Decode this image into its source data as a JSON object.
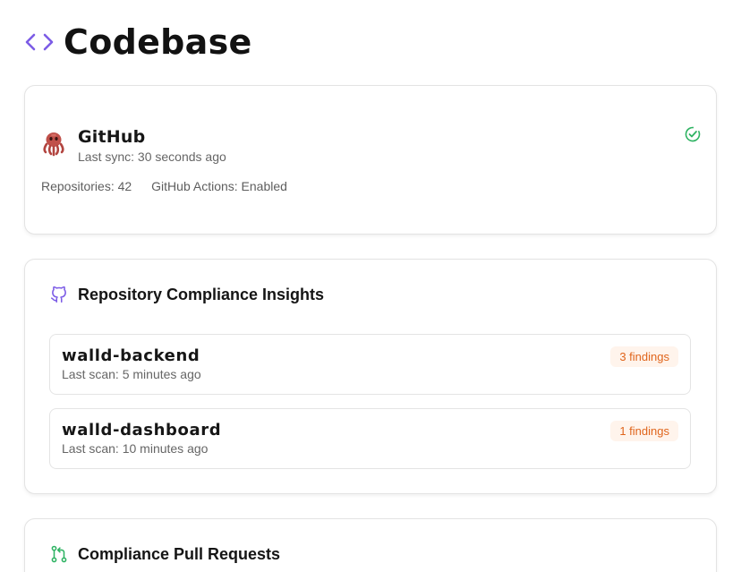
{
  "header": {
    "title": "Codebase",
    "icon": "code-brackets-icon",
    "accent": "#7c5ce6"
  },
  "integration": {
    "name": "GitHub",
    "last_sync": "Last sync: 30 seconds ago",
    "repositories": "Repositories: 42",
    "actions": "GitHub Actions: Enabled",
    "status_icon": "check-circle-icon",
    "status_color": "#2fb363"
  },
  "insights": {
    "title": "Repository Compliance Insights",
    "icon": "github-icon",
    "repos": [
      {
        "name": "walld-backend",
        "last_scan": "Last scan: 5 minutes ago",
        "findings": "3 findings"
      },
      {
        "name": "walld-dashboard",
        "last_scan": "Last scan: 10 minutes ago",
        "findings": "1 findings"
      }
    ],
    "badge_color": "#e0651c"
  },
  "pull_requests": {
    "title": "Compliance Pull Requests",
    "icon": "git-pull-request-icon",
    "icon_color": "#2fb363"
  }
}
